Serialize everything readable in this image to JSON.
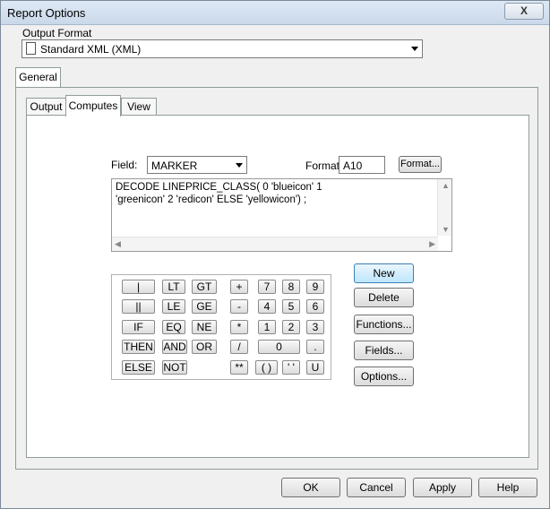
{
  "window": {
    "title": "Report Options",
    "close_glyph": "X"
  },
  "output_format": {
    "label": "Output Format",
    "value": "Standard XML (XML)"
  },
  "outer_tabs": [
    {
      "label": "General"
    }
  ],
  "inner_tabs": [
    {
      "label": "Output"
    },
    {
      "label": "Computes"
    },
    {
      "label": "View"
    }
  ],
  "compute": {
    "field_label": "Field:",
    "field_value": "MARKER",
    "format_label": "Format:",
    "format_value": "A10",
    "format_button": "Format...",
    "expression_lines": [
      "DECODE LINEPRICE_CLASS( 0 'blueicon' 1",
      "'greenicon' 2 'redicon' ELSE 'yellowicon') ;"
    ]
  },
  "keypad": {
    "keys": [
      "|",
      "LT",
      "GT",
      "+",
      "7",
      "8",
      "9",
      "||",
      "LE",
      "GE",
      "-",
      "4",
      "5",
      "6",
      "IF",
      "EQ",
      "NE",
      "*",
      "1",
      "2",
      "3",
      "THEN",
      "AND",
      "OR",
      "/",
      "0",
      ".",
      "ELSE",
      "NOT",
      "**",
      "( )",
      "' '",
      "U"
    ]
  },
  "side_buttons": {
    "new": "New",
    "delete": "Delete",
    "functions": "Functions...",
    "fields": "Fields...",
    "options": "Options..."
  },
  "footer": {
    "ok": "OK",
    "cancel": "Cancel",
    "apply": "Apply",
    "help": "Help"
  }
}
